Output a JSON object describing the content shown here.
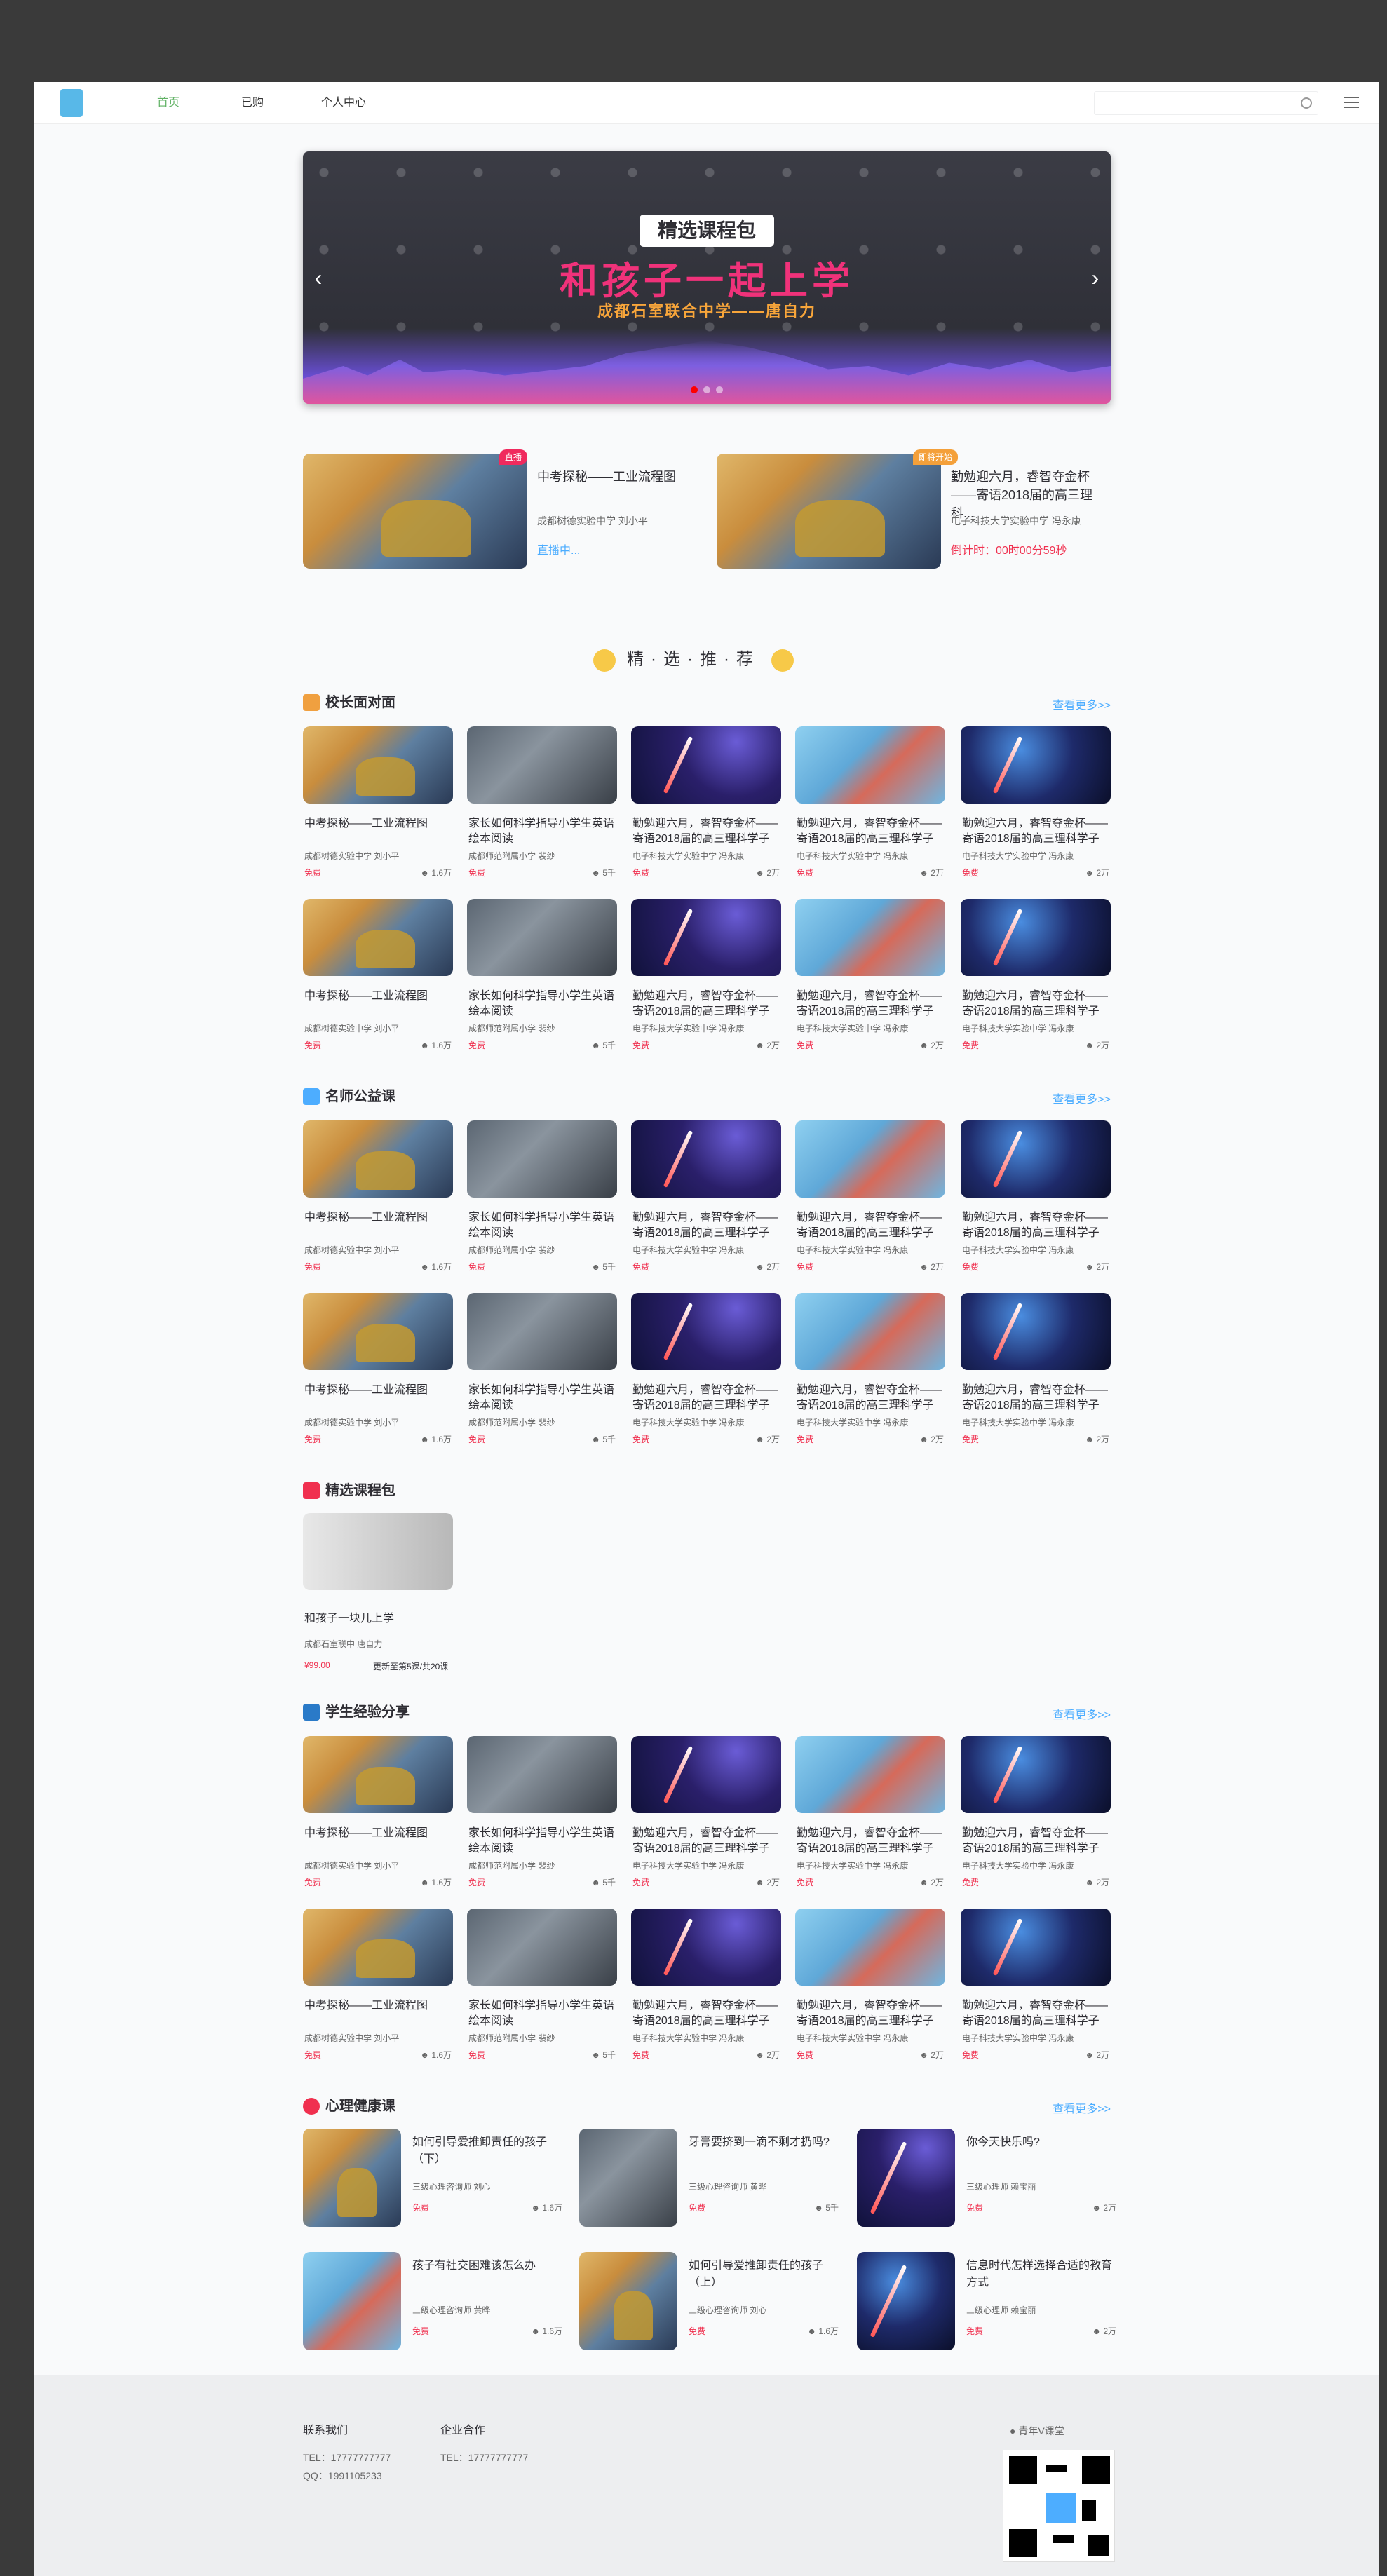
{
  "header": {
    "nav": [
      "首页",
      "已购",
      "个人中心"
    ],
    "search_placeholder": ""
  },
  "banner": {
    "badge": "精选课程包",
    "title": "和孩子一起上学",
    "subtitle": "成都石室联合中学——唐自力"
  },
  "live": [
    {
      "tag": "直播",
      "tag_color": "#f02a5e",
      "title": "中考探秘——工业流程图",
      "sub": "成都树德实验中学  刘小平",
      "status": "直播中...",
      "status_color": "#4dadff"
    },
    {
      "tag": "即将开始",
      "tag_color": "#f4a03a",
      "title": "勤勉迎六月，睿智夺金杯——寄语2018届的高三理科...",
      "sub": "电子科技大学实验中学  冯永康",
      "status": "倒计时：00时00分59秒",
      "status_color": "#f0304f"
    }
  ],
  "recommend_title": "精·选·推·荐",
  "sections": {
    "s1": {
      "title": "校长面对面",
      "more": "查看更多>>"
    },
    "s2": {
      "title": "名师公益课",
      "more": "查看更多>>"
    },
    "s3": {
      "title": "精选课程包",
      "more": ""
    },
    "s4": {
      "title": "学生经验分享",
      "more": "查看更多>>"
    },
    "s5": {
      "title": "心理健康课",
      "more": "查看更多>>"
    }
  },
  "cards": [
    {
      "title": "中考探秘——工业流程图",
      "sub": "成都树德实验中学  刘小平",
      "free": "免费",
      "count": "1.6万"
    },
    {
      "title": "家长如何科学指导小学生英语绘本阅读",
      "sub": "成都师范附属小学  裴纱",
      "free": "免费",
      "count": "5千"
    },
    {
      "title": "勤勉迎六月，睿智夺金杯——寄语2018届的高三理科学子",
      "sub": "电子科技大学实验中学  冯永康",
      "free": "免费",
      "count": "2万"
    },
    {
      "title": "勤勉迎六月，睿智夺金杯——寄语2018届的高三理科学子",
      "sub": "电子科技大学实验中学  冯永康",
      "free": "免费",
      "count": "2万"
    },
    {
      "title": "勤勉迎六月，睿智夺金杯——寄语2018届的高三理科学子",
      "sub": "电子科技大学实验中学  冯永康",
      "free": "免费",
      "count": "2万"
    }
  ],
  "package": {
    "title": "和孩子一块儿上学",
    "sub": "成都石室联中  唐自力",
    "price": "¥99.00",
    "update": "更新至第5课/共20课"
  },
  "psych": [
    {
      "title": "如何引导爱推卸责任的孩子（下）",
      "sub": "三级心理咨询师  刘心",
      "free": "免费",
      "count": "1.6万"
    },
    {
      "title": "牙膏要挤到一滴不剩才扔吗?",
      "sub": "三级心理咨询师  黄晔",
      "free": "免费",
      "count": "5千"
    },
    {
      "title": "你今天快乐吗?",
      "sub": "三级心理师  赖宝丽",
      "free": "免费",
      "count": "2万"
    },
    {
      "title": "孩子有社交困难该怎么办",
      "sub": "三级心理咨询师  黄晔",
      "free": "免费",
      "count": "1.6万"
    },
    {
      "title": "如何引导爱推卸责任的孩子（上）",
      "sub": "三级心理咨询师  刘心",
      "free": "免费",
      "count": "1.6万"
    },
    {
      "title": "信息时代怎样选择合适的教育方式",
      "sub": "三级心理师  赖宝丽",
      "free": "免费",
      "count": "2万"
    }
  ],
  "footer": {
    "contact": "联系我们",
    "coop": "企业合作",
    "tel1": "TEL：17777777777",
    "qq": "QQ：1991105233",
    "tel2": "TEL：17777777777",
    "qr_label": "青年V课堂"
  }
}
